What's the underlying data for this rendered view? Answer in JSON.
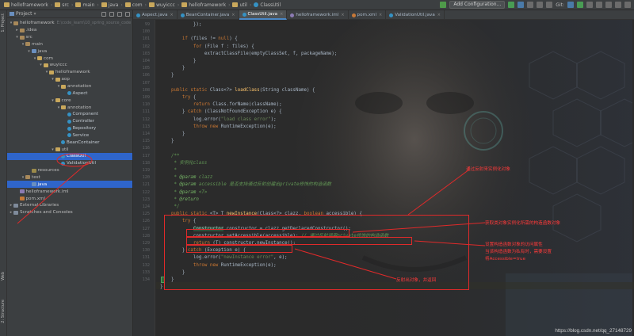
{
  "navbar": {
    "crumbs": [
      "helloframework",
      "src",
      "main",
      "java",
      "com",
      "wuyiccc",
      "helloframework",
      "util",
      "ClassUtil"
    ],
    "add_config": "Add Configuration...",
    "git_label": "Git:"
  },
  "left_stripe": {
    "project_tab": "1: Project",
    "structure_tab": "2: Structure",
    "web_tab": "Web"
  },
  "project_panel": {
    "title": "Project",
    "tree": [
      {
        "label": "helloframework",
        "hint": "E:\\code_learn\\10_spring_source_code",
        "indent": 0,
        "icon": "folder",
        "arrow": "▾"
      },
      {
        "label": ".idea",
        "indent": 1,
        "icon": "folder",
        "arrow": "▸"
      },
      {
        "label": "src",
        "indent": 1,
        "icon": "folder",
        "arrow": "▾"
      },
      {
        "label": "main",
        "indent": 2,
        "icon": "folder",
        "arrow": "▾"
      },
      {
        "label": "java",
        "indent": 3,
        "icon": "src",
        "arrow": "▾"
      },
      {
        "label": "com",
        "indent": 4,
        "icon": "pkg",
        "arrow": "▾"
      },
      {
        "label": "wuyiccc",
        "indent": 5,
        "icon": "pkg",
        "arrow": "▾"
      },
      {
        "label": "helloframework",
        "indent": 6,
        "icon": "pkg",
        "arrow": "▾"
      },
      {
        "label": "aop",
        "indent": 7,
        "icon": "pkg",
        "arrow": "▾"
      },
      {
        "label": "annotation",
        "indent": 8,
        "icon": "pkg",
        "arrow": "▾"
      },
      {
        "label": "Aspect",
        "indent": 9,
        "icon": "class",
        "arrow": ""
      },
      {
        "label": "core",
        "indent": 7,
        "icon": "pkg",
        "arrow": "▾"
      },
      {
        "label": "annotation",
        "indent": 8,
        "icon": "pkg",
        "arrow": "▾"
      },
      {
        "label": "Component",
        "indent": 9,
        "icon": "class",
        "arrow": ""
      },
      {
        "label": "Controller",
        "indent": 9,
        "icon": "class",
        "arrow": ""
      },
      {
        "label": "Repository",
        "indent": 9,
        "icon": "class",
        "arrow": ""
      },
      {
        "label": "Service",
        "indent": 9,
        "icon": "class",
        "arrow": ""
      },
      {
        "label": "BeanContainer",
        "indent": 8,
        "icon": "class",
        "arrow": ""
      },
      {
        "label": "util",
        "indent": 7,
        "icon": "pkg",
        "arrow": "▾"
      },
      {
        "label": "ClassUtil",
        "indent": 8,
        "icon": "class",
        "arrow": "",
        "selected": true
      },
      {
        "label": "ValidationUtil",
        "indent": 8,
        "icon": "class",
        "arrow": ""
      },
      {
        "label": "resources",
        "indent": 3,
        "icon": "res",
        "arrow": ""
      },
      {
        "label": "test",
        "indent": 2,
        "icon": "folder",
        "arrow": "▾"
      },
      {
        "label": "java",
        "indent": 3,
        "icon": "src",
        "arrow": "",
        "selected": true
      },
      {
        "label": "helloframework.iml",
        "indent": 1,
        "icon": "iml",
        "arrow": ""
      },
      {
        "label": "pom.xml",
        "indent": 1,
        "icon": "xml",
        "arrow": ""
      },
      {
        "label": "External Libraries",
        "indent": 0,
        "icon": "lib",
        "arrow": "▸"
      },
      {
        "label": "Scratches and Consoles",
        "indent": 0,
        "icon": "lib",
        "arrow": "▸"
      }
    ]
  },
  "tabs": [
    {
      "label": "Aspect.java",
      "color": "#3592c4",
      "active": false
    },
    {
      "label": "BeanContainer.java",
      "color": "#3592c4",
      "active": false
    },
    {
      "label": "ClassUtil.java",
      "color": "#3592c4",
      "active": true
    },
    {
      "label": "helloframework.iml",
      "color": "#8c7bb3",
      "active": false
    },
    {
      "label": "pom.xml",
      "color": "#c67838",
      "active": false
    },
    {
      "label": "ValidationUtil.java",
      "color": "#3592c4",
      "active": false
    }
  ],
  "editor": {
    "line_numbers": [
      "99",
      "100",
      "101",
      "102",
      "103",
      "104",
      "105",
      "106",
      "107",
      "108",
      "109",
      "110",
      "111",
      "112",
      "113",
      "114",
      "115",
      "116",
      "117",
      "118",
      "119",
      "120",
      "121",
      "122",
      "123",
      "124",
      "125",
      "126",
      "127",
      "128",
      "129",
      "130",
      "131",
      "132",
      "133",
      "134"
    ],
    "lines": [
      [
        {
          "t": "            });"
        }
      ],
      [
        {
          "t": ""
        }
      ],
      [
        {
          "t": "        "
        },
        {
          "t": "if",
          "c": "kw"
        },
        {
          "t": " (files != "
        },
        {
          "t": "null",
          "c": "kw"
        },
        {
          "t": ") {"
        }
      ],
      [
        {
          "t": "            "
        },
        {
          "t": "for",
          "c": "kw"
        },
        {
          "t": " (File f : files) {"
        }
      ],
      [
        {
          "t": "                extractClassFile(emptyClassSet, f, packageName);"
        }
      ],
      [
        {
          "t": "            }"
        }
      ],
      [
        {
          "t": "        }"
        }
      ],
      [
        {
          "t": "    }"
        }
      ],
      [
        {
          "t": ""
        }
      ],
      [
        {
          "t": "    "
        },
        {
          "t": "public static",
          "c": "kw"
        },
        {
          "t": " Class<?> "
        },
        {
          "t": "loadClass",
          "c": "fn"
        },
        {
          "t": "(String className) {"
        }
      ],
      [
        {
          "t": "        "
        },
        {
          "t": "try",
          "c": "kw"
        },
        {
          "t": " {"
        }
      ],
      [
        {
          "t": "            "
        },
        {
          "t": "return",
          "c": "kw"
        },
        {
          "t": " Class.forName(className);"
        }
      ],
      [
        {
          "t": "        } "
        },
        {
          "t": "catch",
          "c": "kw"
        },
        {
          "t": " (ClassNotFoundException e) {"
        }
      ],
      [
        {
          "t": "            log.error("
        },
        {
          "t": "\"load class error\"",
          "c": "str"
        },
        {
          "t": ");"
        }
      ],
      [
        {
          "t": "            "
        },
        {
          "t": "throw new",
          "c": "kw"
        },
        {
          "t": " RuntimeException(e);"
        }
      ],
      [
        {
          "t": "        }"
        }
      ],
      [
        {
          "t": "    }"
        }
      ],
      [
        {
          "t": ""
        }
      ],
      [
        {
          "t": "    /**",
          "c": "cm"
        }
      ],
      [
        {
          "t": "     * 实例化class",
          "c": "cm"
        }
      ],
      [
        {
          "t": "     *",
          "c": "cm"
        }
      ],
      [
        {
          "t": "     * ",
          "c": "cm"
        },
        {
          "t": "@param",
          "c": "tag"
        },
        {
          "t": " clazz",
          "c": "cm"
        }
      ],
      [
        {
          "t": "     * ",
          "c": "cm"
        },
        {
          "t": "@param",
          "c": "tag"
        },
        {
          "t": " accessible 是否支持通过反射创建出private修饰的构造函数",
          "c": "cm"
        }
      ],
      [
        {
          "t": "     * ",
          "c": "cm"
        },
        {
          "t": "@param",
          "c": "tag"
        },
        {
          "t": " <T>",
          "c": "cm"
        }
      ],
      [
        {
          "t": "     * ",
          "c": "cm"
        },
        {
          "t": "@return",
          "c": "tag"
        }
      ],
      [
        {
          "t": "     */",
          "c": "cm"
        }
      ],
      [
        {
          "t": "    "
        },
        {
          "t": "public static",
          "c": "kw"
        },
        {
          "t": " <T> T "
        },
        {
          "t": "newInstance",
          "c": "fn"
        },
        {
          "t": "(Class<?> clazz, "
        },
        {
          "t": "boolean",
          "c": "kw"
        },
        {
          "t": " accessible) {"
        }
      ],
      [
        {
          "t": "        "
        },
        {
          "t": "try",
          "c": "kw"
        },
        {
          "t": " {"
        }
      ],
      [
        {
          "t": "            "
        },
        {
          "t": "Constructor",
          "c": "hl"
        },
        {
          "t": " constructor = clazz.getDeclaredConstructor();"
        }
      ],
      [
        {
          "t": "            constructor.setAccessible(accessible); "
        },
        {
          "t": "// 通过反射调用private修饰的构造函数",
          "c": "cm"
        }
      ],
      [
        {
          "t": "            "
        },
        {
          "t": "return",
          "c": "kw"
        },
        {
          "t": " (T) constructor.newInstance();"
        }
      ],
      [
        {
          "t": "        } "
        },
        {
          "t": "catch",
          "c": "kw"
        },
        {
          "t": " (Exception e) {"
        }
      ],
      [
        {
          "t": "            log.error("
        },
        {
          "t": "\"newInstance error\"",
          "c": "str"
        },
        {
          "t": ", e);"
        }
      ],
      [
        {
          "t": "            "
        },
        {
          "t": "throw new",
          "c": "kw"
        },
        {
          "t": " RuntimeException(e);"
        }
      ],
      [
        {
          "t": "        }"
        }
      ],
      [
        {
          "t": "    }"
        }
      ]
    ],
    "last_line": "}"
  },
  "annotations": {
    "a1": "通过反射来实例化对象",
    "a2": "获取类对象实例化所需的构造函数对象",
    "a3_1": "设置构造函数对象的访问属性",
    "a3_2": "当该构造函数为私有时，需要设置",
    "a3_3": "将Accessible=true",
    "a4": "反射出对象，并返回"
  },
  "watermark": "https://blog.csdn.net/qq_27148729",
  "colors": {
    "accent": "#2f65ca",
    "annotation_red": "#e02a2a"
  }
}
